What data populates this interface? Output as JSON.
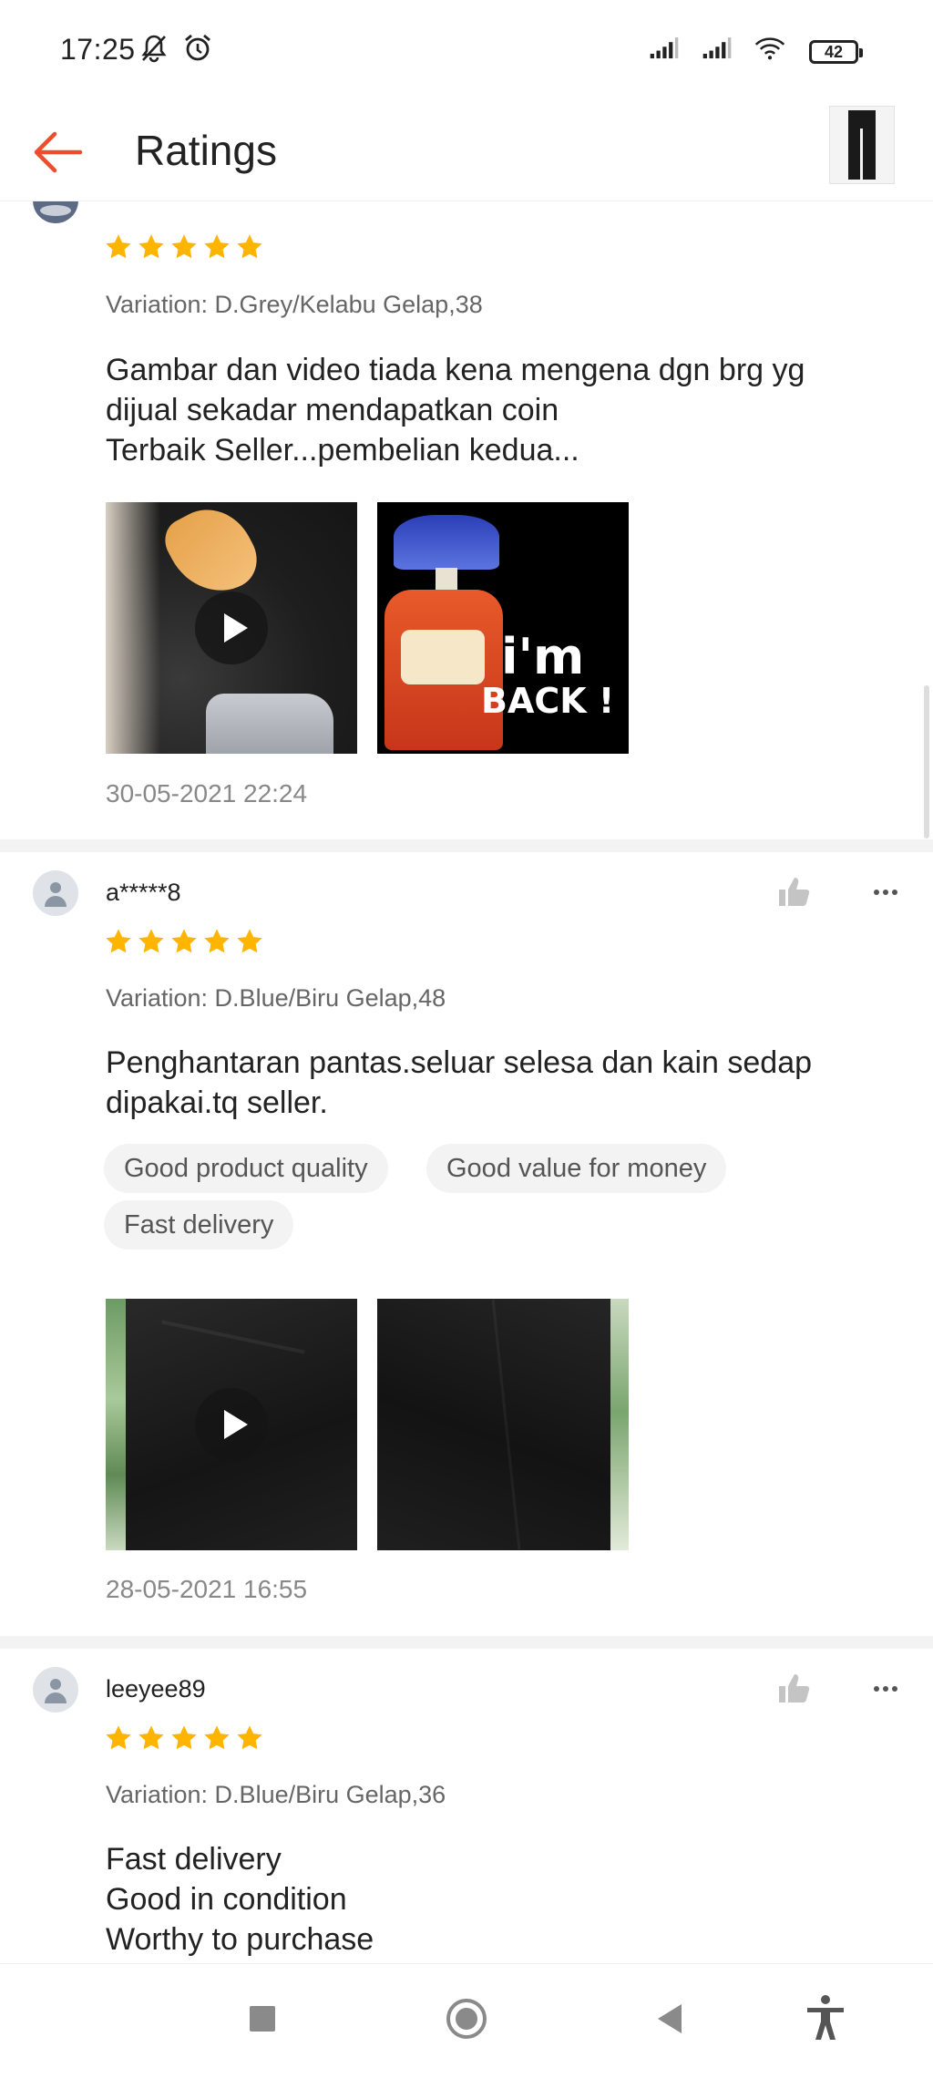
{
  "status_bar": {
    "time": "17:25",
    "battery_level": "42",
    "icons": [
      "notifications-muted-icon",
      "alarm-icon",
      "signal-1-icon",
      "signal-2-icon",
      "wifi-icon",
      "battery-icon"
    ]
  },
  "header": {
    "back_icon": "arrow-left-icon",
    "title": "Ratings",
    "product_thumbnail": "black-pants-thumbnail"
  },
  "colors": {
    "accent": "#ee4d2d",
    "star": "#ffb400",
    "text_primary": "#222222",
    "text_secondary": "#666666",
    "timestamp": "#888888",
    "tag_bg": "#f3f3f3"
  },
  "reviews": [
    {
      "username": "",
      "rating": 5,
      "variation": "Variation: D.Grey/Kelabu Gelap,38",
      "comment_lines": [
        "Gambar dan video tiada kena mengena dgn brg yg",
        "dijual sekadar mendapatkan coin",
        "Terbaik Seller...pembelian kedua..."
      ],
      "tags": [],
      "media": [
        {
          "kind": "video",
          "subject": "gorilla-with-banana"
        },
        {
          "kind": "image",
          "subject": "bread-bag-im-back",
          "overlay_text": [
            "i'm",
            "BACK !"
          ]
        }
      ],
      "timestamp": "30-05-2021 22:24"
    },
    {
      "username": "a*****8",
      "rating": 5,
      "variation": "Variation: D.Blue/Biru Gelap,48",
      "comment_lines": [
        "Penghantaran pantas.seluar selesa dan kain sedap",
        "dipakai.tq seller."
      ],
      "tags": [
        "Good product quality",
        "Good value for money",
        "Fast delivery"
      ],
      "media": [
        {
          "kind": "video",
          "subject": "black-trousers"
        },
        {
          "kind": "image",
          "subject": "black-trousers"
        }
      ],
      "timestamp": "28-05-2021 16:55"
    },
    {
      "username": "leeyee89",
      "rating": 5,
      "variation": "Variation: D.Blue/Biru Gelap,36",
      "comment_lines": [
        "Fast delivery",
        "Good in condition",
        "Worthy to purchase"
      ],
      "tags": [],
      "media": [],
      "timestamp": ""
    }
  ],
  "nav_bar": {
    "buttons": [
      "recents-square-icon",
      "home-circle-icon",
      "back-triangle-icon",
      "accessibility-icon"
    ]
  }
}
